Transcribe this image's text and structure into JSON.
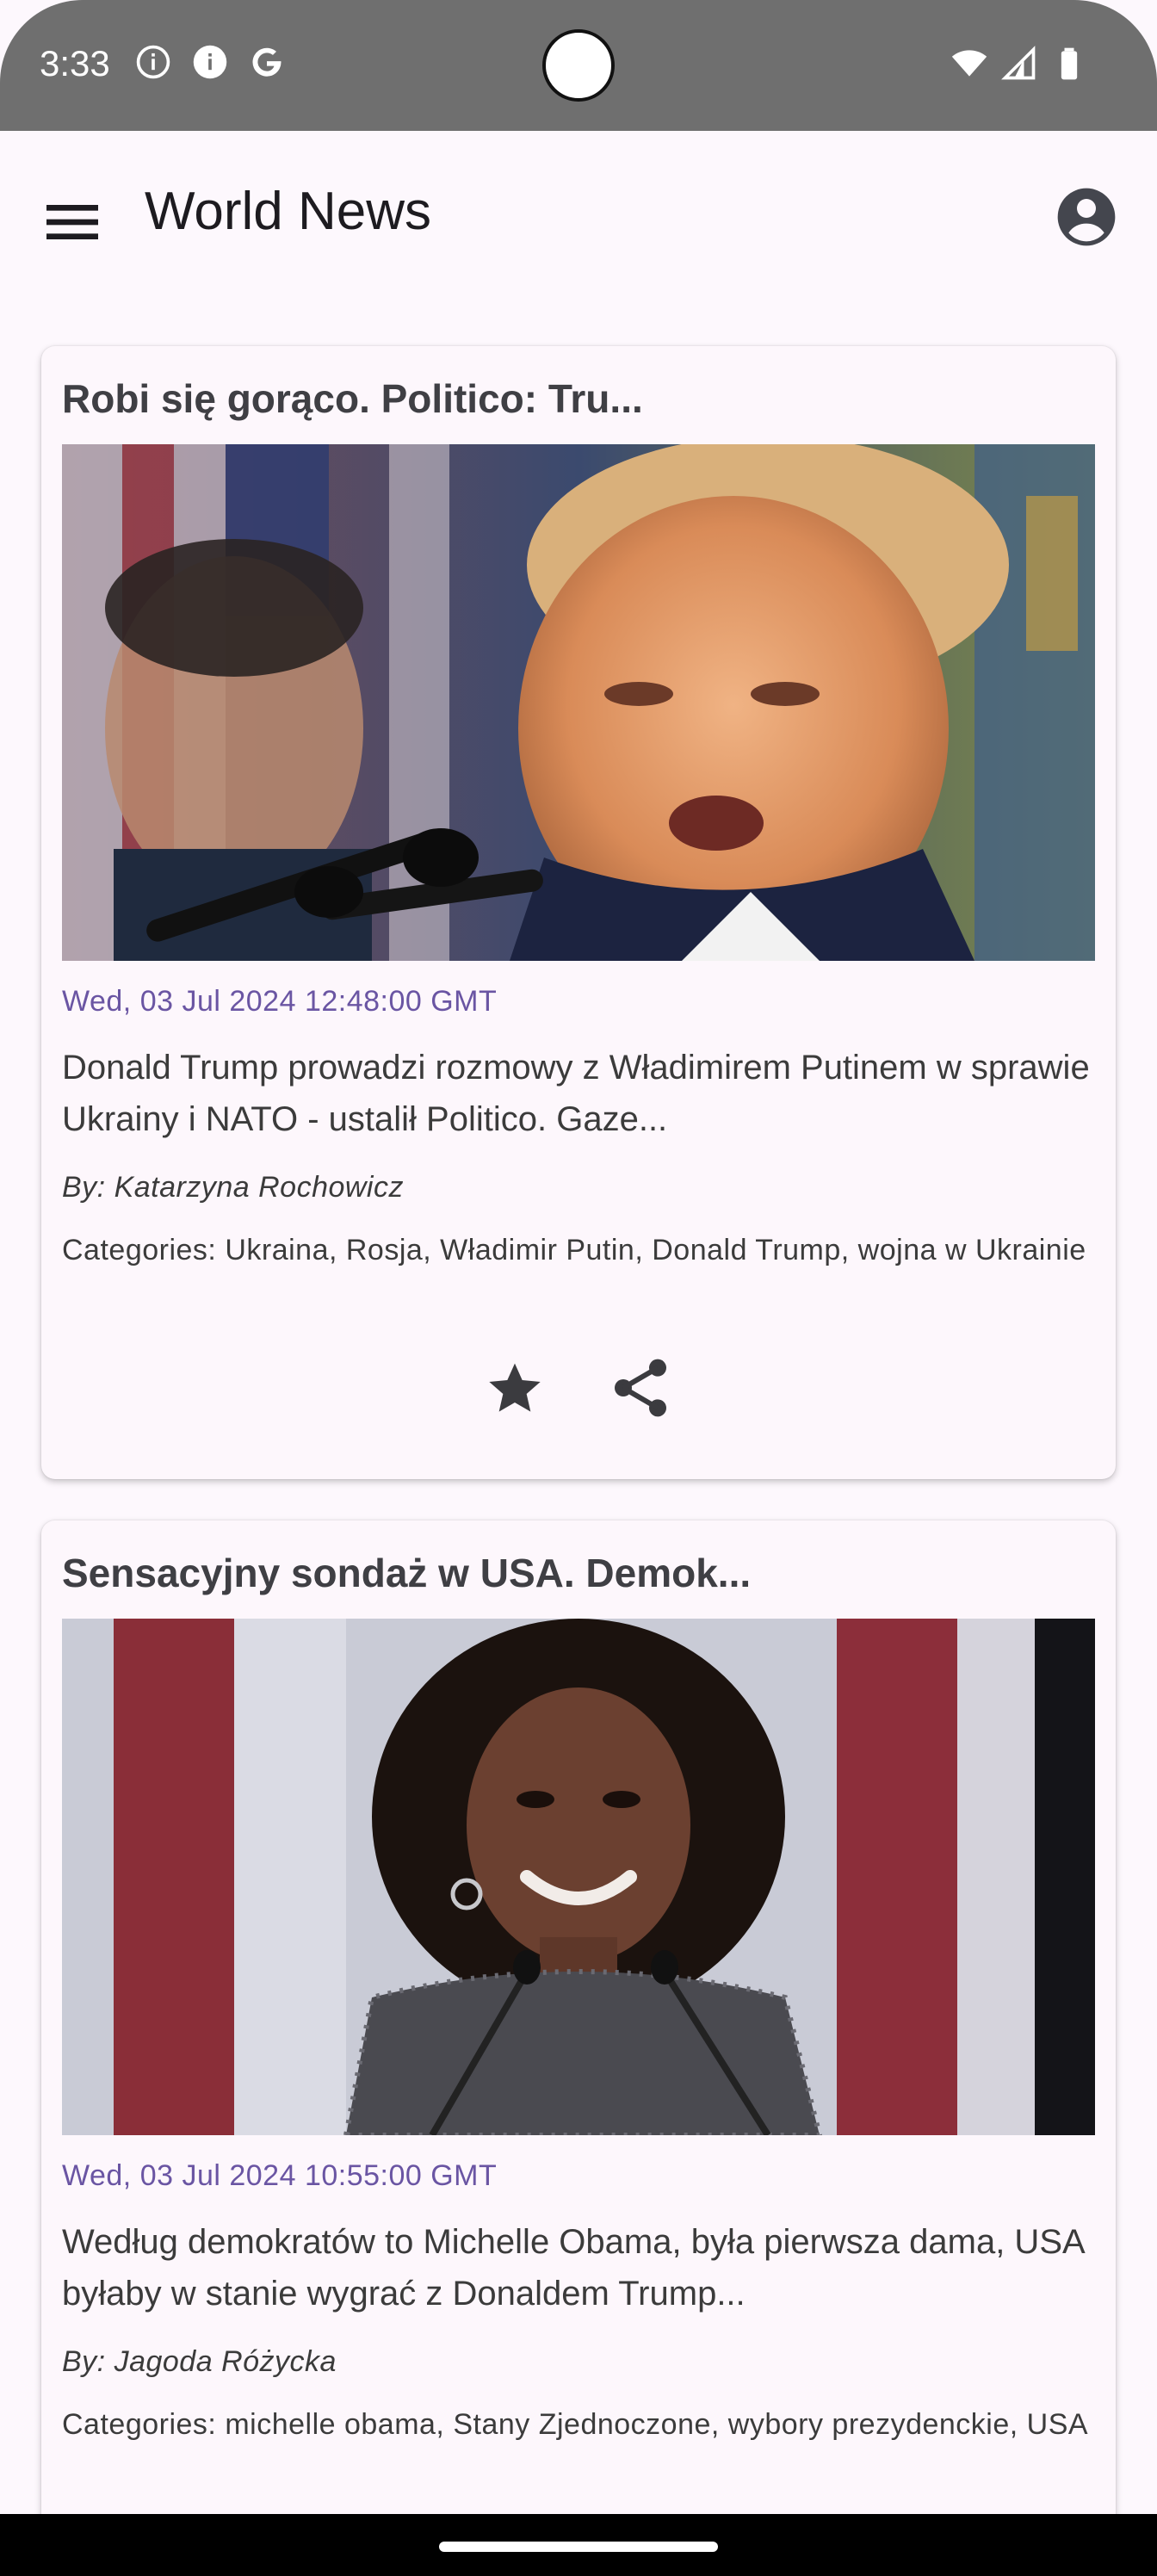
{
  "status_bar": {
    "time": "3:33",
    "left_icons": [
      "info-outline-icon",
      "info-filled-icon",
      "google-g-icon"
    ],
    "right_icons": [
      "wifi-icon",
      "cell-signal-icon",
      "battery-icon"
    ]
  },
  "app_bar": {
    "title": "World News",
    "menu_icon": "menu-icon",
    "account_icon": "account-circle-icon"
  },
  "colors": {
    "background": "#fdf8fd",
    "card": "#fdf7fc",
    "date_accent": "#6a55a3",
    "status_bar": "#6f6f6f"
  },
  "articles": [
    {
      "title": "Robi się gorąco. Politico: Tru...",
      "date": "Wed, 03 Jul 2024 12:48:00 GMT",
      "description": "Donald Trump prowadzi rozmowy z Władimirem Putinem w sprawie Ukrainy i NATO - ustalił Politico. Gaze...",
      "author": "By: Katarzyna Rochowicz",
      "categories": "Categories: Ukraina, Rosja, Władimir Putin, Donald Trump, wojna w Ukrainie",
      "actions": [
        "star-icon",
        "share-icon"
      ]
    },
    {
      "title": "Sensacyjny sondaż w USA. Demok...",
      "date": "Wed, 03 Jul 2024 10:55:00 GMT",
      "description": "Według demokratów to Michelle Obama, była pierwsza dama, USA byłaby w stanie wygrać z Donaldem Trump...",
      "author": "By: Jagoda Różycka",
      "categories": "Categories: michelle obama, Stany Zjednoczone, wybory prezydenckie, USA"
    }
  ]
}
